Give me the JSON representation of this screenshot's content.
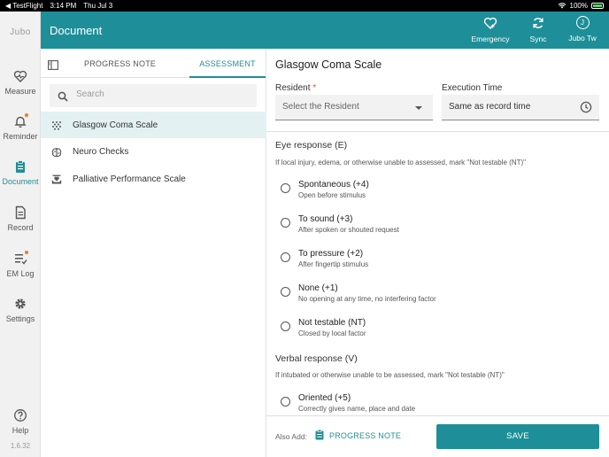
{
  "status_bar": {
    "back_app": "◀ TestFlight",
    "time": "3:14 PM",
    "date": "Thu Jul 3",
    "battery": "100%"
  },
  "rail": {
    "logo": "Jubo",
    "items": [
      {
        "label": "Measure",
        "icon": "heart-monitor-icon"
      },
      {
        "label": "Reminder",
        "icon": "bell-icon"
      },
      {
        "label": "Document",
        "icon": "clipboard-icon"
      },
      {
        "label": "Record",
        "icon": "document-icon"
      },
      {
        "label": "EM Log",
        "icon": "list-icon"
      },
      {
        "label": "Settings",
        "icon": "gear-icon"
      },
      {
        "label": "Help",
        "icon": "help-icon"
      }
    ],
    "version": "1.6.32"
  },
  "header": {
    "title": "Document",
    "emergency": "Emergency",
    "sync": "Sync",
    "user": "Jubo Tw",
    "avatar_initial": "J"
  },
  "list": {
    "tabs": [
      "PROGRESS NOTE",
      "ASSESSMENT"
    ],
    "search_placeholder": "Search",
    "items": [
      "Glasgow Coma Scale",
      "Neuro Checks",
      "Palliative Performance Scale"
    ]
  },
  "form": {
    "title": "Glasgow Coma Scale",
    "resident_label": "Resident",
    "required_mark": "*",
    "resident_placeholder": "Select the Resident",
    "exec_label": "Execution Time",
    "exec_value": "Same as record time",
    "eye": {
      "title": "Eye response (E)",
      "hint": "If local injury, edema, or otherwise unable to assessed, mark \"Not testable (NT)\"",
      "options": [
        {
          "label": "Spontaneous (+4)",
          "sub": "Open before stimulus"
        },
        {
          "label": "To sound (+3)",
          "sub": "After spoken or shouted request"
        },
        {
          "label": "To pressure (+2)",
          "sub": "After fingertip stimulus"
        },
        {
          "label": "None (+1)",
          "sub": "No opening at any time, no interfering factor"
        },
        {
          "label": "Not testable (NT)",
          "sub": "Closed by local factor"
        }
      ]
    },
    "verbal": {
      "title": "Verbal response (V)",
      "hint": "If intubated or otherwise unable to be assessed, mark \"Not testable (NT)\"",
      "options": [
        {
          "label": "Oriented (+5)",
          "sub": "Correctly gives name, place and date"
        }
      ]
    }
  },
  "footer": {
    "also_add": "Also Add:",
    "progress_note": "PROGRESS NOTE",
    "save": "SAVE"
  },
  "colors": {
    "accent": "#1e8f98",
    "notify": "#f07b2b"
  }
}
